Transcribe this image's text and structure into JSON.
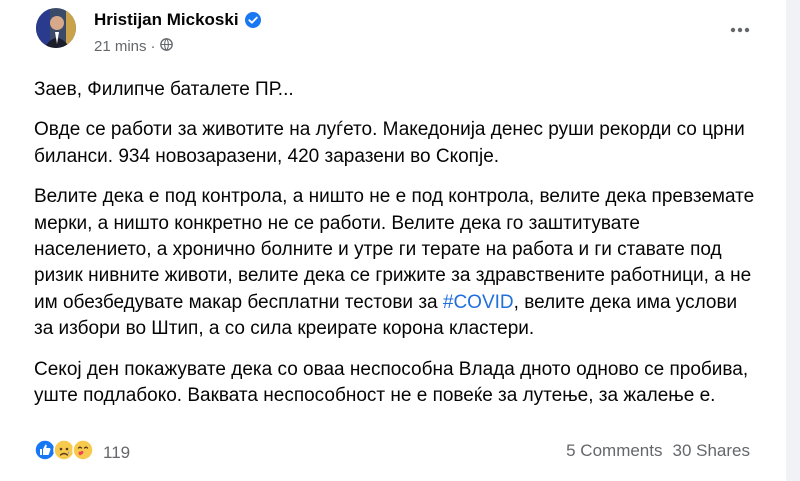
{
  "post": {
    "author": "Hristijan Mickoski",
    "timestamp": "21 mins",
    "privacy_icon": "globe-icon",
    "verified_icon": "verified-badge-icon",
    "paragraphs": {
      "p1": "Заев, Филипче баталете ПР...",
      "p2": "Овде се работи за животите на луѓето. Македонија денес руши рекорди со црни биланси. 934 новозаразени, 420 заразени во Скопје.",
      "p3_before": "Велите дека е под контрола, а ништо не е под контрола, велите дека превземате мерки, а ништо конкретно не се работи. Велите дека го заштитувате населението, а хронично болните и утре ги терате на работа и ги ставате под ризик нивните животи, велите дека се грижите за здравствените работници, а не им обезбедувате макар бесплатни тестови за ",
      "p3_hashtag": "#COVID",
      "p3_after": ", велите дека има услови за избори во Штип, а со сила креирате корона кластери.",
      "p4": "Секој ден покажувате дека со оваа неспособна Влада дното одново се пробива, уште подлабоко. Ваквата неспособност не е повеќе за лутење, за жалење е."
    }
  },
  "footer": {
    "reaction_icons": [
      "like-icon",
      "sad-icon",
      "care-icon"
    ],
    "reactions_count": "119",
    "comments": "5 Comments",
    "shares": "30 Shares"
  },
  "colors": {
    "text": "#050505",
    "secondary": "#65676b",
    "link": "#216fdb",
    "verified": "#1877f2"
  }
}
